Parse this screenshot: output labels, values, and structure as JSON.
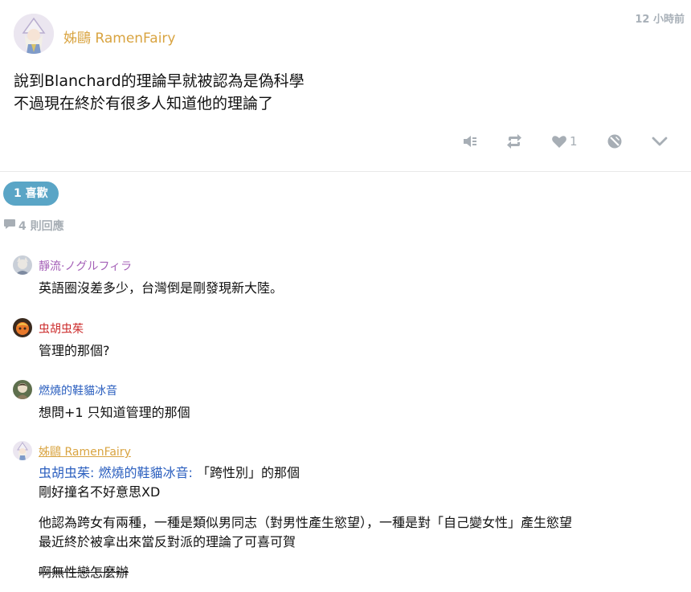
{
  "post": {
    "author": "姊鷗 RamenFairy",
    "timestamp": "12 小時前",
    "body_lines": [
      "說到Blanchard的理論早就被認為是偽科學",
      "不過現在終於有很多人知道他的理論了"
    ],
    "like_count": "1",
    "icons": [
      "mute-icon",
      "share-icon",
      "heart-icon",
      "block-icon",
      "chevron-down-icon"
    ]
  },
  "likes_pill": "1 喜歡",
  "reply_count": "4 則回應",
  "comments": [
    {
      "author": "靜流·ノグルフィラ",
      "author_color": "#a45fb7",
      "text": "英語圈沒差多少，台灣倒是剛發現新大陸。"
    },
    {
      "author": "虫胡虫茱",
      "author_color": "#cc2b2b",
      "text": "管理的那個?"
    },
    {
      "author": "燃燒的鞋貓冰音",
      "author_color": "#2b5fbf",
      "text": "想問+1 只知道管理的那個"
    },
    {
      "author": "姊鷗 RamenFairy",
      "author_color": "#d9a441",
      "mention1": "虫胡虫茱",
      "mention_sep": ": ",
      "mention2": "燃燒的鞋貓冰音",
      "mention_tail": ":",
      "line1_rest": " 「跨性別」的那個",
      "line2": "剛好撞名不好意思XD",
      "line3": "他認為跨女有兩種，一種是類似男同志（對男性產生慾望），一種是對「自己變女性」產生慾望",
      "line4": "最近終於被拿出來當反對派的理論了可喜可賀",
      "line5_strike": "啊無性戀怎麼辦"
    }
  ],
  "colors": {
    "accent": "#5aa5c6",
    "muted": "#a7aeb5",
    "author_gold": "#d9a441",
    "mention_blue": "#2b5fbf"
  }
}
